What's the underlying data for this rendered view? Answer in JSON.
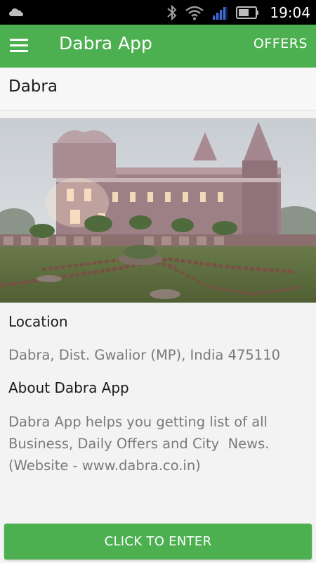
{
  "status_bar": {
    "time": "19:04",
    "icons": [
      "cloud-icon",
      "bluetooth-icon",
      "wifi-icon",
      "signal-icon",
      "battery-icon"
    ]
  },
  "app_bar": {
    "title": "Dabra App",
    "menu_icon": "hamburger-menu-icon",
    "offers_label": "OFFERS",
    "color": "#4caf50"
  },
  "page": {
    "title": "Dabra"
  },
  "location": {
    "heading": "Location",
    "text": "Dabra, Dist. Gwalior (MP), India 475110"
  },
  "about": {
    "heading": "About Dabra App",
    "line1": "Dabra App helps you getting list of all",
    "line2": "Business, Daily Offers and City  News.",
    "line3": "(Website - www.dabra.co.in)"
  },
  "footer": {
    "enter_label": "CLICK TO ENTER"
  }
}
